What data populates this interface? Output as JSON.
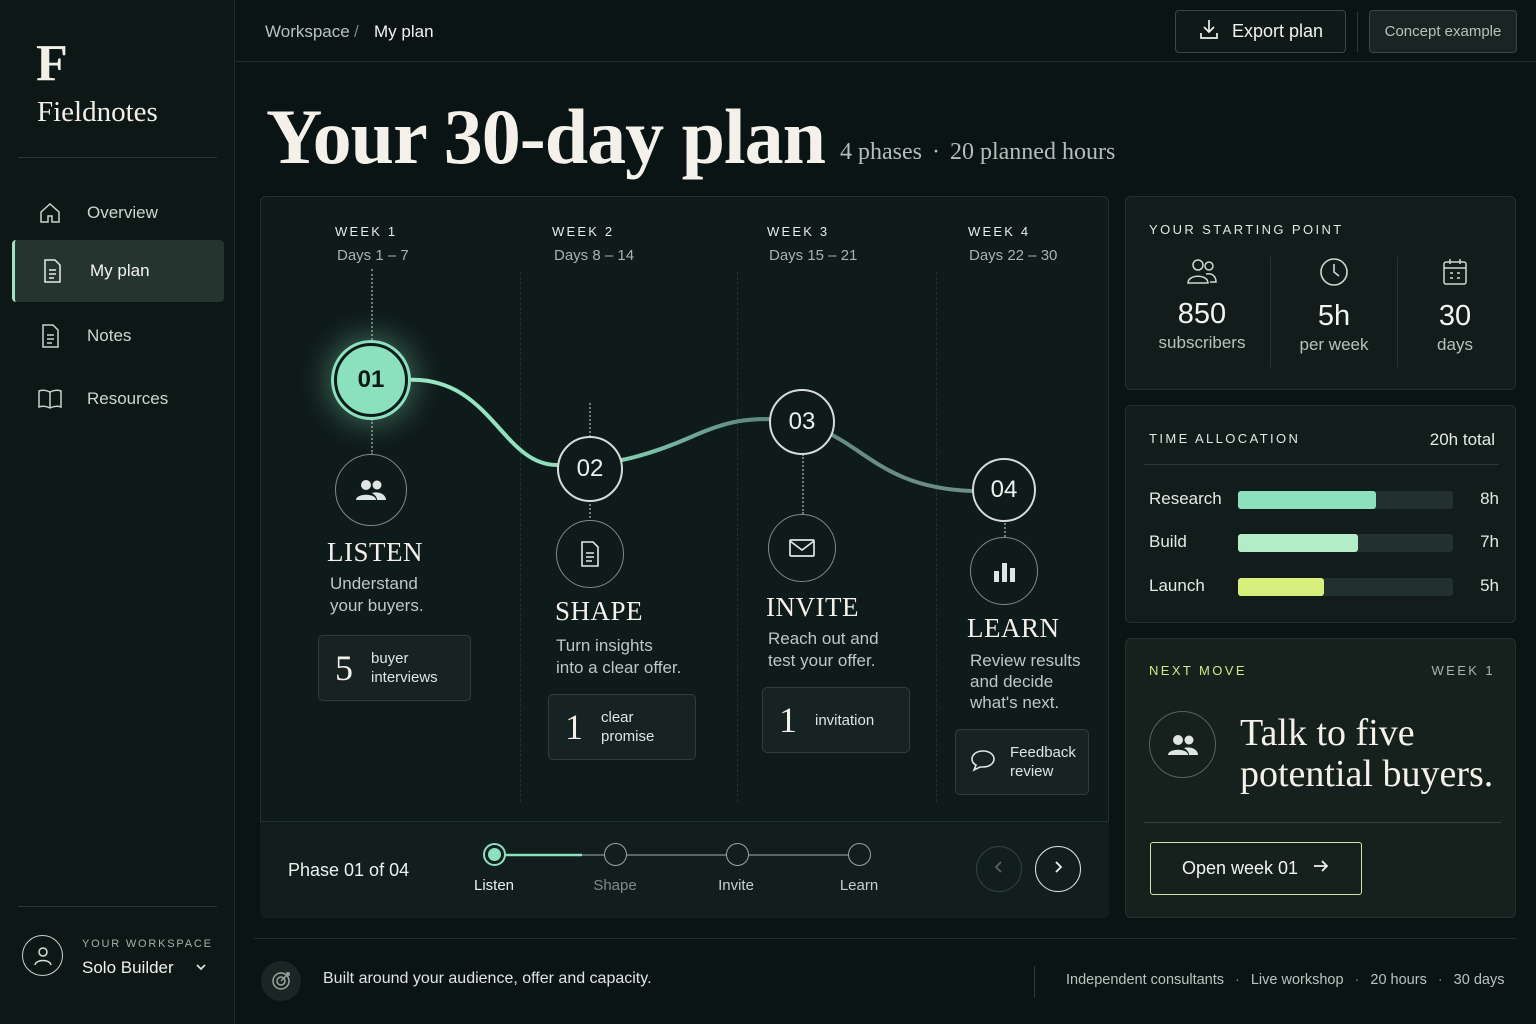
{
  "brand": {
    "mark": "F",
    "name": "Fieldnotes"
  },
  "sidebar": {
    "items": [
      {
        "label": "Overview",
        "icon": "home-icon"
      },
      {
        "label": "My plan",
        "icon": "document-icon",
        "active": true
      },
      {
        "label": "Notes",
        "icon": "note-icon"
      },
      {
        "label": "Resources",
        "icon": "book-icon"
      }
    ],
    "workspace": {
      "label": "YOUR WORKSPACE",
      "name": "Solo Builder"
    }
  },
  "header": {
    "breadcrumb": [
      "Workspace",
      "/",
      "My plan"
    ],
    "export_label": "Export plan",
    "concept_label": "Concept example"
  },
  "title": {
    "main": "Your 30-day plan",
    "phases": "4 phases",
    "dot": "·",
    "hours": "20 planned hours"
  },
  "timeline": {
    "weeks": [
      {
        "label": "WEEK 1",
        "days": "Days 1 – 7"
      },
      {
        "label": "WEEK 2",
        "days": "Days 8 – 14"
      },
      {
        "label": "WEEK 3",
        "days": "Days 15 – 21"
      },
      {
        "label": "WEEK 4",
        "days": "Days 22 – 30"
      }
    ],
    "phases": [
      {
        "num": "01",
        "name": "LISTEN",
        "desc1": "Understand",
        "desc2": "your buyers.",
        "desc3": "",
        "stat_big": "5",
        "stat_l1": "buyer",
        "stat_l2": "interviews",
        "icon": "people-icon"
      },
      {
        "num": "02",
        "name": "SHAPE",
        "desc1": "Turn insights",
        "desc2": "into a clear offer.",
        "desc3": "",
        "stat_big": "1",
        "stat_l1": "clear",
        "stat_l2": "promise",
        "icon": "document-icon"
      },
      {
        "num": "03",
        "name": "INVITE",
        "desc1": "Reach out and",
        "desc2": "test your offer.",
        "desc3": "",
        "stat_big": "1",
        "stat_l1": "invitation",
        "stat_l2": "",
        "icon": "mail-icon"
      },
      {
        "num": "04",
        "name": "LEARN",
        "desc1": "Review results",
        "desc2": "and decide",
        "desc3": "what's next.",
        "stat_big": "",
        "stat_l1": "Feedback",
        "stat_l2": "review",
        "icon": "bar-chart-icon"
      }
    ]
  },
  "stepper": {
    "label": "Phase 01 of 04",
    "steps": [
      "Listen",
      "Shape",
      "Invite",
      "Learn"
    ],
    "current": 1
  },
  "starting_point": {
    "label": "YOUR STARTING POINT",
    "items": [
      {
        "value": "850",
        "unit": "subscribers",
        "icon": "users-icon"
      },
      {
        "value": "5h",
        "unit": "per week",
        "icon": "clock-icon"
      },
      {
        "value": "30",
        "unit": "days",
        "icon": "calendar-icon"
      }
    ]
  },
  "time_allocation": {
    "label": "TIME ALLOCATION",
    "total": "20h total",
    "rows": [
      {
        "name": "Research",
        "value": "8h",
        "hours": 8,
        "color": "#8be0bd"
      },
      {
        "name": "Build",
        "value": "7h",
        "hours": 7,
        "color": "#b3ecc9"
      },
      {
        "name": "Launch",
        "value": "5h",
        "hours": 5,
        "color": "#d7ef7c"
      }
    ]
  },
  "next_move": {
    "label": "NEXT MOVE",
    "week": "WEEK 1",
    "line1": "Talk to five",
    "line2": "potential buyers.",
    "button": "Open week 01"
  },
  "footer": {
    "text": "Built around your audience, offer and capacity.",
    "tags": [
      "Independent consultants",
      "Live workshop",
      "20 hours",
      "30 days"
    ],
    "sep": "·"
  },
  "colors": {
    "accent": "#8be0bd",
    "lime": "#d7ef7c",
    "bg": "#0b1414"
  }
}
